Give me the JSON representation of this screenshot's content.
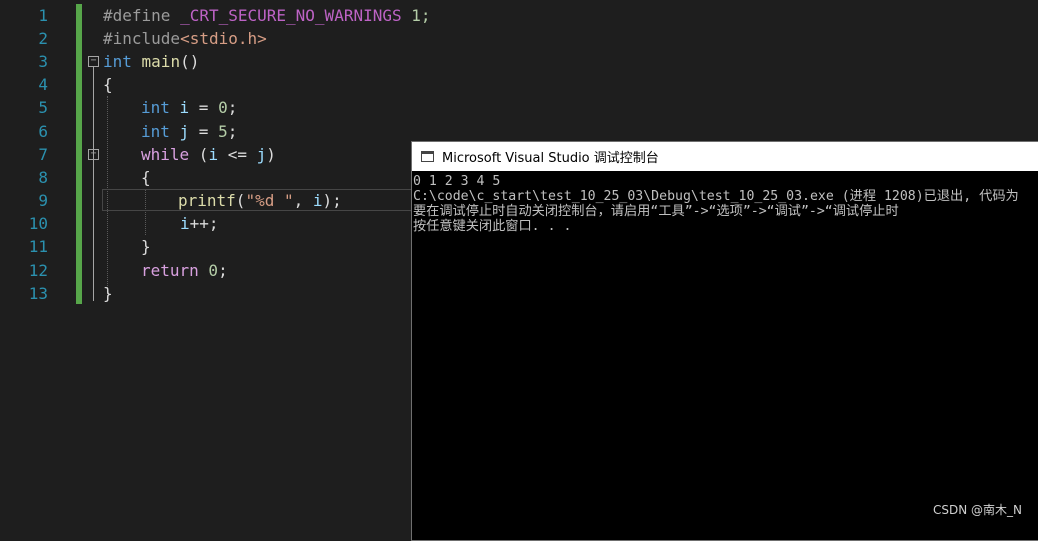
{
  "editor": {
    "line_numbers": [
      "1",
      "2",
      "3",
      "4",
      "5",
      "6",
      "7",
      "8",
      "9",
      "10",
      "11",
      "12",
      "13"
    ],
    "tokens": {
      "l1_define": "#define ",
      "l1_macro": "_CRT_SECURE_NO_WARNINGS",
      "l1_value": " 1;",
      "l2_include": "#include",
      "l2_header": "<stdio.h>",
      "l3_type": "int",
      "l3_fn": " main",
      "l3_parens": "()",
      "l4_brace": "{",
      "l5_type": "int",
      "l5_var": " i",
      "l5_assign": " = ",
      "l5_num": "0",
      "l5_semi": ";",
      "l6_type": "int",
      "l6_var": " j",
      "l6_assign": " = ",
      "l6_num": "5",
      "l6_semi": ";",
      "l7_kw": "while",
      "l7_open": " (",
      "l7_var_i": "i",
      "l7_op": " <= ",
      "l7_var_j": "j",
      "l7_close": ")",
      "l8_brace": "{",
      "l9_fn": "printf",
      "l9_open": "(",
      "l9_str": "\"%d \"",
      "l9_comma": ", ",
      "l9_var": "i",
      "l9_close": ");",
      "l10_var": "i",
      "l10_op": "++;",
      "l11_brace": "}",
      "l12_kw": "return",
      "l12_num": " 0",
      "l12_semi": ";",
      "l13_brace": "}"
    }
  },
  "console": {
    "title": "Microsoft Visual Studio 调试控制台",
    "lines": [
      "0 1 2 3 4 5",
      "C:\\code\\c_start\\test_10_25_03\\Debug\\test_10_25_03.exe (进程 1208)已退出, 代码为",
      "要在调试停止时自动关闭控制台，请启用“工具”->“选项”->“调试”->“调试停止时",
      "按任意键关闭此窗口. . ."
    ]
  },
  "watermark": "CSDN @南木_N",
  "colors": {
    "editor_bg": "#1e1e1e",
    "line_number": "#2b91af",
    "keyword": "#569cd6",
    "function": "#dcdcaa",
    "string": "#d69d85",
    "number": "#b5cea8",
    "variable": "#9cdcfe",
    "control": "#d8a0df",
    "macro": "#bd63c5",
    "change_bar": "#57a64a"
  },
  "icons": {
    "console_window": "console-window-icon",
    "fold_collapse": "fold-collapse-icon"
  }
}
